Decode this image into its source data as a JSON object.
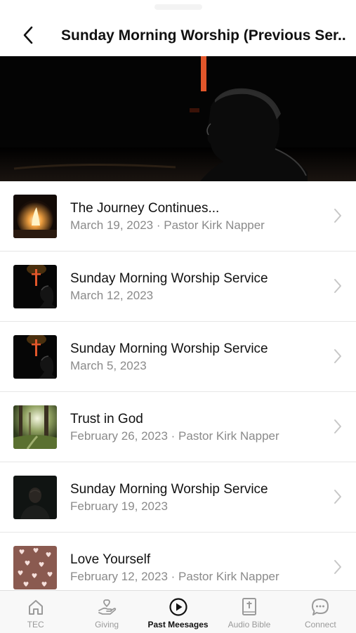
{
  "header": {
    "title": "Sunday Morning Worship (Previous Ser...",
    "back_icon": "chevron-left-icon"
  },
  "sermons": [
    {
      "title": "The Journey Continues...",
      "subtitle": "March 19, 2023 · Pastor Kirk Napper",
      "thumb": "fire"
    },
    {
      "title": "Sunday Morning Worship Service",
      "subtitle": "March 12, 2023",
      "thumb": "cross"
    },
    {
      "title": "Sunday Morning Worship Service",
      "subtitle": "March 5, 2023",
      "thumb": "cross"
    },
    {
      "title": "Trust in God",
      "subtitle": "February 26, 2023 · Pastor Kirk Napper",
      "thumb": "forest"
    },
    {
      "title": "Sunday Morning Worship Service",
      "subtitle": "February 19, 2023",
      "thumb": "portrait"
    },
    {
      "title": "Love Yourself",
      "subtitle": "February 12, 2023 · Pastor Kirk Napper",
      "thumb": "hearts"
    }
  ],
  "tabs": [
    {
      "label": "TEC",
      "icon": "home-icon",
      "active": false
    },
    {
      "label": "Giving",
      "icon": "giving-hand-icon",
      "active": false
    },
    {
      "label": "Past Meesages",
      "icon": "play-circle-icon",
      "active": true
    },
    {
      "label": "Audio Bible",
      "icon": "bible-icon",
      "active": false
    },
    {
      "label": "Connect",
      "icon": "chat-bubble-icon",
      "active": false
    }
  ],
  "colors": {
    "text_primary": "#111111",
    "text_secondary": "#8a8a8a",
    "tab_inactive": "#9a9a9a",
    "divider": "#e6e6e6"
  }
}
